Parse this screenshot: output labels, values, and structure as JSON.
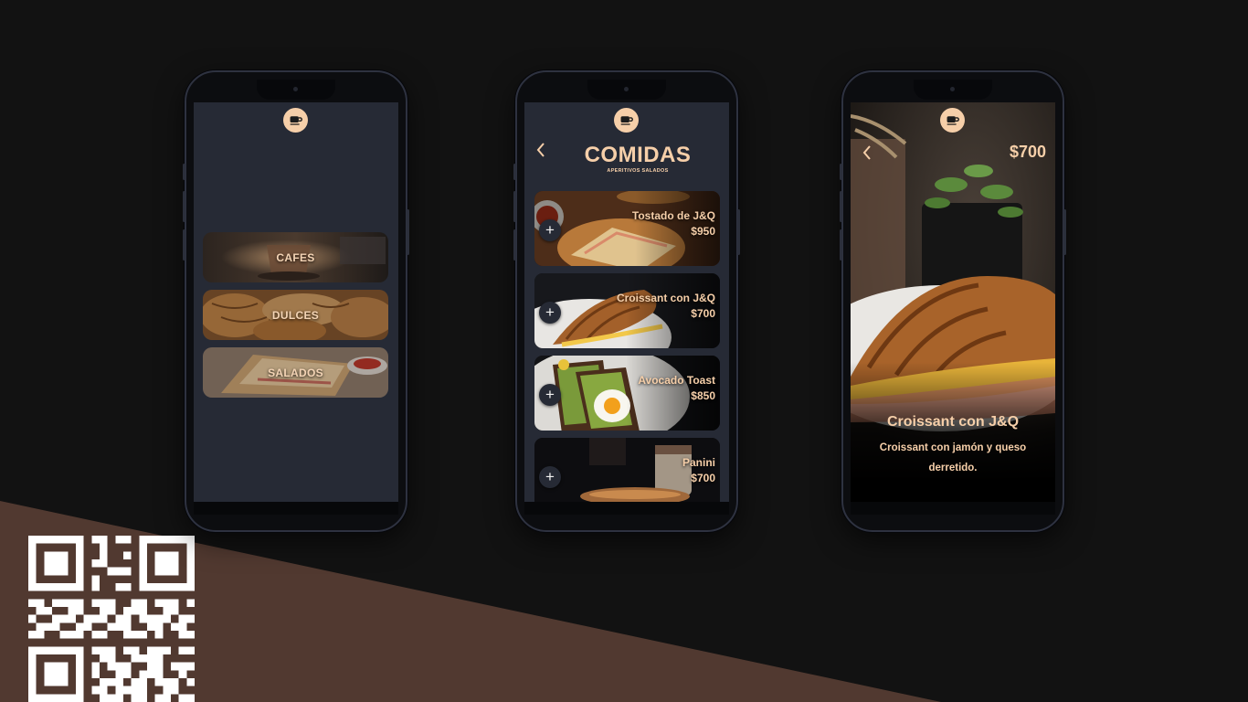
{
  "colors": {
    "accent": "#f6cfa9",
    "background": "#121212",
    "wedge": "#513930",
    "screen": "#262a35"
  },
  "icons": {
    "logo": "coffee-cup-icon",
    "back": "chevron-left-icon",
    "add": "plus-icon"
  },
  "home_screen": {
    "categories": [
      {
        "label": "CAFES"
      },
      {
        "label": "DULCES"
      },
      {
        "label": "SALADOS"
      }
    ]
  },
  "list_screen": {
    "title": "COMIDAS",
    "subtitle": "APERITIVOS SALADOS",
    "back_glyph": "‹",
    "add_glyph": "+",
    "items": [
      {
        "name": "Tostado de J&Q",
        "price": "$950"
      },
      {
        "name": "Croissant con J&Q",
        "price": "$700"
      },
      {
        "name": "Avocado Toast",
        "price": "$850"
      },
      {
        "name": "Panini",
        "price": "$700"
      }
    ]
  },
  "detail_screen": {
    "back_glyph": "‹",
    "price": "$700",
    "name": "Croissant con J&Q",
    "description": "Croissant con jamón y queso derretido."
  }
}
